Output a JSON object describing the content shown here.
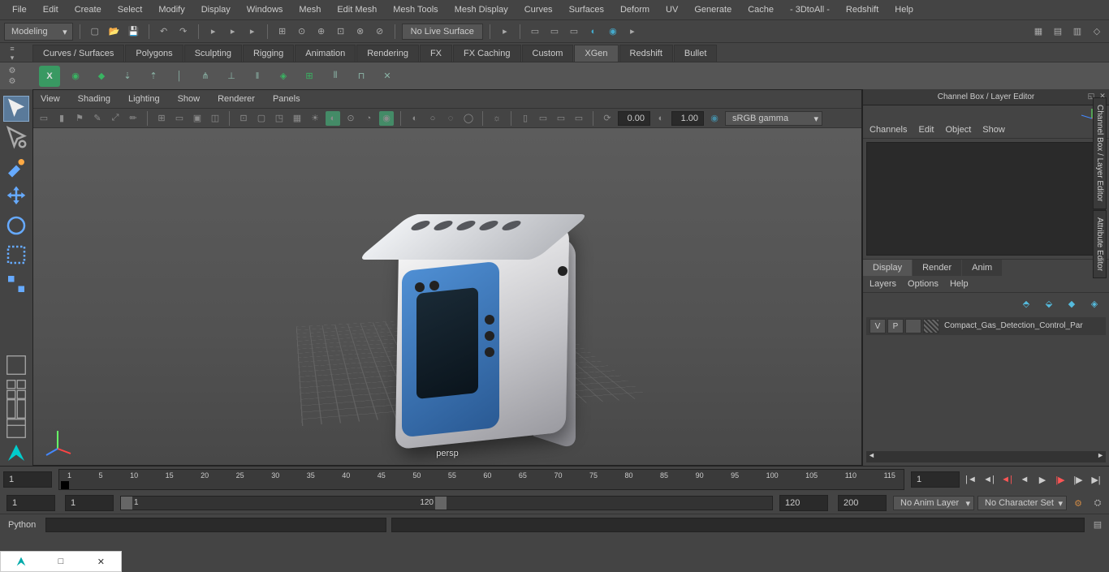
{
  "menubar": [
    "File",
    "Edit",
    "Create",
    "Select",
    "Modify",
    "Display",
    "Windows",
    "Mesh",
    "Edit Mesh",
    "Mesh Tools",
    "Mesh Display",
    "Curves",
    "Surfaces",
    "Deform",
    "UV",
    "Generate",
    "Cache",
    "- 3DtoAll -",
    "Redshift",
    "Help"
  ],
  "workspace": "Modeling",
  "live_surface": "No Live Surface",
  "shelf_tabs": [
    "Curves / Surfaces",
    "Polygons",
    "Sculpting",
    "Rigging",
    "Animation",
    "Rendering",
    "FX",
    "FX Caching",
    "Custom",
    "XGen",
    "Redshift",
    "Bullet"
  ],
  "shelf_active": "XGen",
  "viewport_menu": [
    "View",
    "Shading",
    "Lighting",
    "Show",
    "Renderer",
    "Panels"
  ],
  "field_a": "0.00",
  "field_b": "1.00",
  "color_mgmt": "sRGB gamma",
  "camera": "persp",
  "channel_box": {
    "title": "Channel Box / Layer Editor",
    "menu": [
      "Channels",
      "Edit",
      "Object",
      "Show"
    ]
  },
  "layer_tabs": [
    "Display",
    "Render",
    "Anim"
  ],
  "layer_tabs_active": "Display",
  "layer_menu": [
    "Layers",
    "Options",
    "Help"
  ],
  "layers": [
    {
      "v": "V",
      "p": "P",
      "name": "Compact_Gas_Detection_Control_Par"
    }
  ],
  "side_tabs": [
    "Channel Box / Layer Editor",
    "Attribute Editor"
  ],
  "timeline": {
    "start": "1",
    "end": "120",
    "range_start": "1",
    "range_end": "200",
    "current": "1",
    "current2": "1",
    "ticks": [
      "1",
      "5",
      "10",
      "15",
      "20",
      "25",
      "30",
      "35",
      "40",
      "45",
      "50",
      "55",
      "60",
      "65",
      "70",
      "75",
      "80",
      "85",
      "90",
      "95",
      "100",
      "105",
      "110",
      "115"
    ],
    "anim_layer": "No Anim Layer",
    "char_set": "No Character Set"
  },
  "cmd_lang": "Python"
}
